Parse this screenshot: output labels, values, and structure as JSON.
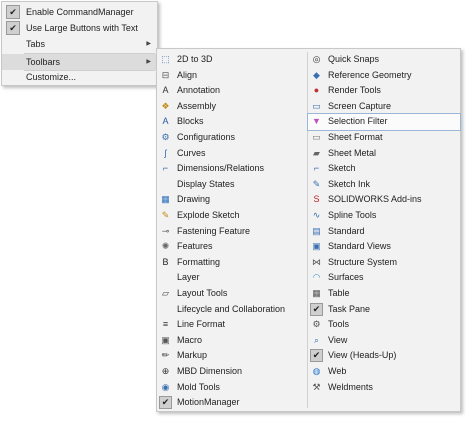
{
  "context_menu": {
    "items": [
      {
        "label": "Enable CommandManager",
        "checked": true
      },
      {
        "label": "Use Large Buttons with Text",
        "checked": true
      },
      {
        "label": "Tabs",
        "submenu": true
      },
      {
        "label": "Toolbars",
        "submenu": true,
        "highlighted": true
      },
      {
        "label": "Customize..."
      }
    ],
    "submenu_arrow": "▶",
    "check_glyph": "✔"
  },
  "toolbars_submenu": {
    "left": [
      {
        "label": "2D to 3D",
        "icon": "2d-to-3d-icon"
      },
      {
        "label": "Align",
        "icon": "align-icon"
      },
      {
        "label": "Annotation",
        "icon": "annotation-icon"
      },
      {
        "label": "Assembly",
        "icon": "assembly-icon"
      },
      {
        "label": "Blocks",
        "icon": "blocks-icon"
      },
      {
        "label": "Configurations",
        "icon": "configurations-icon"
      },
      {
        "label": "Curves",
        "icon": "curves-icon"
      },
      {
        "label": "Dimensions/Relations",
        "icon": "dimensions-icon"
      },
      {
        "label": "Display States",
        "icon": ""
      },
      {
        "label": "Drawing",
        "icon": "drawing-icon"
      },
      {
        "label": "Explode Sketch",
        "icon": "explode-sketch-icon"
      },
      {
        "label": "Fastening Feature",
        "icon": "fastening-icon"
      },
      {
        "label": "Features",
        "icon": "features-icon"
      },
      {
        "label": "Formatting",
        "icon": "formatting-icon"
      },
      {
        "label": "Layer",
        "icon": ""
      },
      {
        "label": "Layout Tools",
        "icon": "layout-tools-icon"
      },
      {
        "label": "Lifecycle and Collaboration",
        "icon": ""
      },
      {
        "label": "Line Format",
        "icon": "line-format-icon"
      },
      {
        "label": "Macro",
        "icon": "macro-icon"
      },
      {
        "label": "Markup",
        "icon": "markup-icon"
      },
      {
        "label": "MBD Dimension",
        "icon": "mbd-icon"
      },
      {
        "label": "Mold Tools",
        "icon": "mold-tools-icon"
      },
      {
        "label": "MotionManager",
        "icon": "check",
        "checked": true
      }
    ],
    "right": [
      {
        "label": "Quick Snaps",
        "icon": "quick-snaps-icon"
      },
      {
        "label": "Reference Geometry",
        "icon": "reference-geometry-icon"
      },
      {
        "label": "Render Tools",
        "icon": "render-tools-icon"
      },
      {
        "label": "Screen Capture",
        "icon": "screen-capture-icon"
      },
      {
        "label": "Selection Filter",
        "icon": "selection-filter-icon",
        "boxed": true
      },
      {
        "label": "Sheet Format",
        "icon": "sheet-format-icon"
      },
      {
        "label": "Sheet Metal",
        "icon": "sheet-metal-icon"
      },
      {
        "label": "Sketch",
        "icon": "sketch-icon"
      },
      {
        "label": "Sketch Ink",
        "icon": "sketch-ink-icon"
      },
      {
        "label": "SOLIDWORKS Add-ins",
        "icon": "addins-icon"
      },
      {
        "label": "Spline Tools",
        "icon": "spline-tools-icon"
      },
      {
        "label": "Standard",
        "icon": "standard-icon"
      },
      {
        "label": "Standard Views",
        "icon": "standard-views-icon"
      },
      {
        "label": "Structure System",
        "icon": "structure-system-icon"
      },
      {
        "label": "Surfaces",
        "icon": "surfaces-icon"
      },
      {
        "label": "Table",
        "icon": "table-icon"
      },
      {
        "label": "Task Pane",
        "icon": "check",
        "checked": true
      },
      {
        "label": "Tools",
        "icon": "tools-icon"
      },
      {
        "label": "View",
        "icon": "view-icon"
      },
      {
        "label": "View (Heads-Up)",
        "icon": "check",
        "checked": true
      },
      {
        "label": "Web",
        "icon": "web-icon"
      },
      {
        "label": "Weldments",
        "icon": "weldments-icon"
      }
    ]
  }
}
